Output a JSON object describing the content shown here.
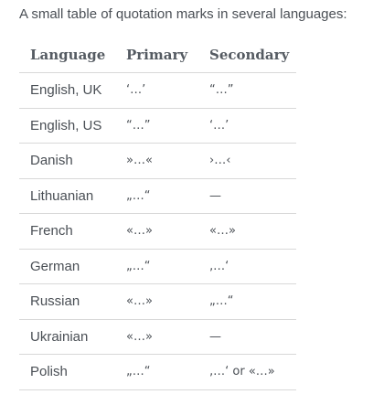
{
  "intro": "A small table of quotation marks in several languages:",
  "table": {
    "headers": [
      "Language",
      "Primary",
      "Secondary"
    ],
    "rows": [
      [
        "English, UK",
        "‘…’",
        "“…”"
      ],
      [
        "English, US",
        "“…”",
        "‘…’"
      ],
      [
        "Danish",
        "»…«",
        "›…‹"
      ],
      [
        "Lithuanian",
        "„…“",
        "—"
      ],
      [
        "French",
        "«…»",
        "«…»"
      ],
      [
        "German",
        "„…“",
        "‚…‘"
      ],
      [
        "Russian",
        "«…»",
        "„…“"
      ],
      [
        "Ukrainian",
        "«…»",
        "—"
      ],
      [
        "Polish",
        "„…“",
        "‚…‘ or «…»"
      ]
    ]
  }
}
